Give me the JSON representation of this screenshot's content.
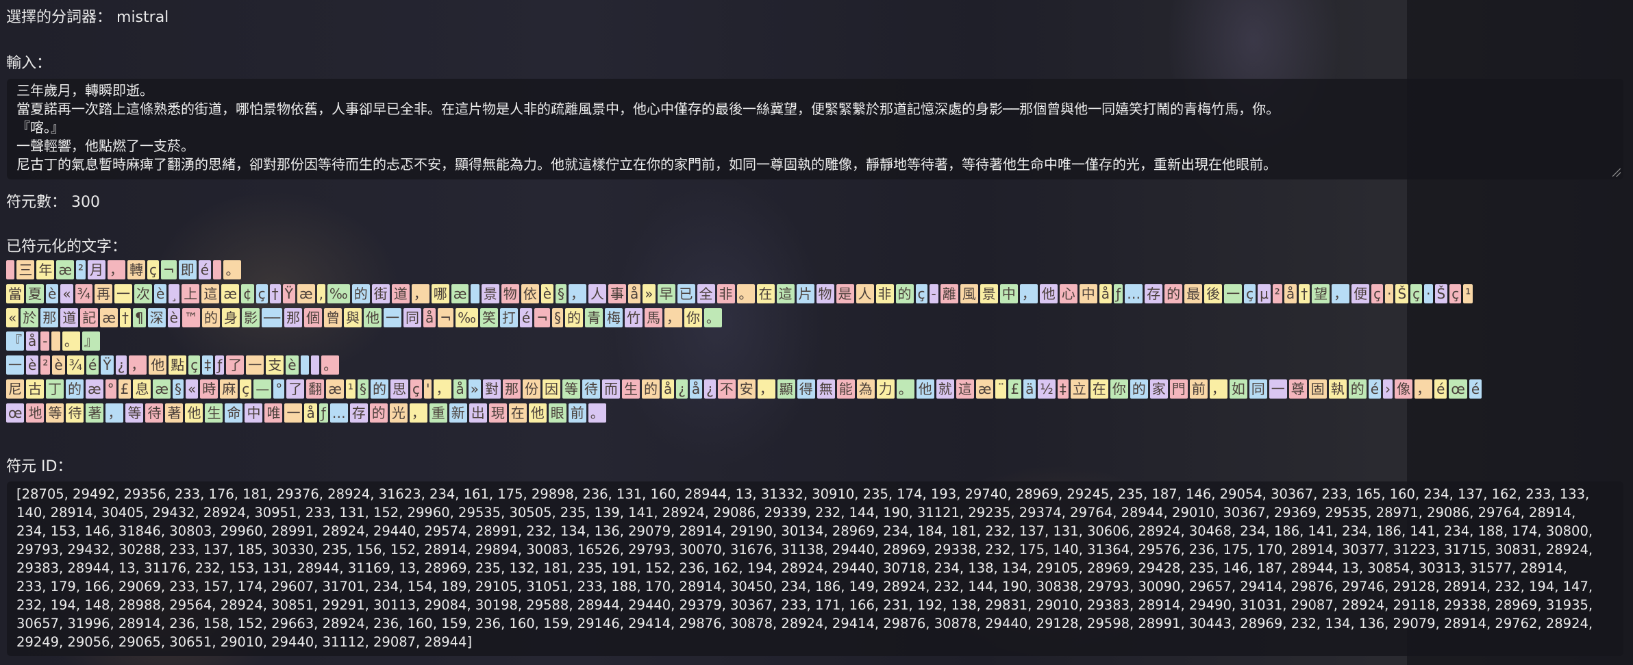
{
  "tokenizer": {
    "label": "選擇的分詞器：",
    "value": "mistral"
  },
  "input": {
    "label": "輸入：",
    "lines": [
      "三年歲月，轉瞬即逝。",
      "當夏諾再一次踏上這條熟悉的街道，哪怕景物依舊，人事卻早已全非。在這片物是人非的疏離風景中，他心中僅存的最後一絲冀望，便緊緊繫於那道記憶深處的身影──那個曾與他一同嬉笑打鬧的青梅竹馬，你。",
      "『喀。』",
      "一聲輕響，他點燃了一支菸。",
      "尼古丁的氣息暫時麻痺了翻湧的思緒，卻對那份因等待而生的忐忑不安，顯得無能為力。他就這樣佇立在你的家門前，如同一尊固執的雕像，靜靜地等待著，等待著他生命中唯一僅存的光，重新出現在他眼前。"
    ]
  },
  "token_count": {
    "label": "符元數：",
    "value": "300"
  },
  "tokenized": {
    "label": "已符元化的文字：",
    "rows": [
      [
        "",
        "三",
        "年",
        "æ",
        "²",
        "月",
        "，",
        "轉",
        "ç",
        "¬",
        "即",
        "é",
        "",
        "。"
      ],
      [
        "當",
        "夏",
        "è",
        "«",
        "¾",
        "再",
        "一",
        "次",
        "è",
        "¸",
        "上",
        "這",
        "æ",
        "¢",
        "ç",
        "†",
        "Ÿ",
        "æ",
        "‚",
        "‰",
        "的",
        "街",
        "道",
        "，",
        "哪",
        "æ",
        "",
        "景",
        "物",
        "依",
        "è",
        "§",
        "，",
        "人",
        "事",
        "å",
        "»",
        "早",
        "已",
        "全",
        "非",
        "。",
        "在",
        "這",
        "片",
        "物",
        "是",
        "人",
        "非",
        "的",
        "ç",
        "-",
        "離",
        "風",
        "景",
        "中",
        "，",
        "他",
        "心",
        "中",
        "å",
        "ƒ",
        "…",
        "存",
        "的",
        "最",
        "後",
        "一",
        "ç",
        "µ",
        "²",
        "å",
        "†",
        "望",
        "，",
        "便",
        "ç",
        "·",
        "Š",
        "ç",
        "·",
        "Š",
        "ç",
        "¹"
      ],
      [
        "«",
        "於",
        "那",
        "道",
        "記",
        "æ",
        "†",
        "¶",
        "深",
        "è",
        "™",
        "的",
        "身",
        "影",
        "──",
        "那",
        "個",
        "曾",
        "與",
        "他",
        "一",
        "同",
        "å",
        "¬",
        "‰",
        "笑",
        "打",
        "é",
        "¬",
        "§",
        "的",
        "青",
        "梅",
        "竹",
        "馬",
        "，",
        "你",
        "。"
      ],
      [
        "『",
        "å",
        "-",
        "",
        "。",
        "』"
      ],
      [
        "一",
        "è",
        "²",
        "è",
        "¾",
        "é",
        "Ÿ",
        "¿",
        "，",
        "他",
        "點",
        "ç",
        "‡",
        "ƒ",
        "了",
        "一",
        "支",
        "è",
        "",
        "",
        "。"
      ],
      [
        "尼",
        "古",
        "丁",
        "的",
        "æ",
        "°",
        "£",
        "息",
        "æ",
        "§",
        "«",
        "時",
        "麻",
        "ç",
        "—",
        "°",
        "了",
        "翻",
        "æ",
        "¹",
        "§",
        "的",
        "思",
        "ç",
        "'",
        "，",
        "å",
        "»",
        "對",
        "那",
        "份",
        "因",
        "等",
        "待",
        "而",
        "生",
        "的",
        "å",
        "¿",
        "å",
        "¿",
        "不",
        "安",
        "，",
        "顯",
        "得",
        "無",
        "能",
        "為",
        "力",
        "。",
        "他",
        "就",
        "這",
        "æ",
        "¨",
        "£",
        "ä",
        "½",
        "‡",
        "立",
        "在",
        "你",
        "的",
        "家",
        "門",
        "前",
        "，",
        "如",
        "同",
        "一",
        "尊",
        "固",
        "執",
        "的",
        "é",
        "›",
        "像",
        "，",
        "é",
        "œ",
        "é"
      ],
      [
        "œ",
        "地",
        "等",
        "待",
        "著",
        "，",
        "等",
        "待",
        "著",
        "他",
        "生",
        "命",
        "中",
        "唯",
        "一",
        "å",
        "ƒ",
        "…",
        "存",
        "的",
        "光",
        "，",
        "重",
        "新",
        "出",
        "現",
        "在",
        "他",
        "眼",
        "前",
        "。"
      ]
    ]
  },
  "token_ids": {
    "label": "符元 ID：",
    "lines": [
      "[28705, 29492, 29356, 233, 176, 181, 29376, 28924, 31623, 234, 161, 175, 29898, 236, 131, 160, 28944, 13, 31332, 30910, 235, 174, 193, 29740, 28969, 29245, 235, 187, 146, 29054, 30367, 233, 165, 160, 234, 137, 162, 233, 133,",
      "140, 28914, 30405, 29432, 28924, 30951, 233, 131, 152, 29960, 29535, 30505, 235, 139, 141, 28924, 29086, 29339, 232, 144, 190, 31121, 29235, 29374, 29764, 28944, 29010, 30367, 29369, 29535, 28971, 29086, 29764, 28914,",
      "234, 153, 146, 31846, 30803, 29960, 28991, 28924, 29440, 29574, 28991, 232, 134, 136, 29079, 28914, 29190, 30134, 28969, 234, 184, 181, 232, 137, 131, 30606, 28924, 30468, 234, 186, 141, 234, 186, 141, 234, 188, 174, 30800,",
      "29793, 29432, 30288, 233, 137, 185, 30330, 235, 156, 152, 28914, 29894, 30083, 16526, 29793, 30070, 31676, 31138, 29440, 28969, 29338, 232, 175, 140, 31364, 29576, 236, 175, 170, 28914, 30377, 31223, 31715, 30831, 28924,",
      "29383, 28944, 13, 31176, 232, 153, 131, 28944, 31169, 13, 28969, 235, 132, 181, 235, 191, 152, 236, 162, 194, 28924, 29440, 30718, 234, 138, 134, 29105, 28969, 29428, 235, 146, 187, 28944, 13, 30854, 30313, 31577, 28914,",
      "233, 179, 166, 29069, 233, 157, 174, 29607, 31701, 234, 154, 189, 29105, 31051, 233, 188, 170, 28914, 30450, 234, 186, 149, 28924, 232, 144, 190, 30838, 29793, 30090, 29657, 29414, 29876, 29746, 29128, 28914, 232, 194, 147,",
      "232, 194, 148, 28988, 29564, 28924, 30851, 29291, 30113, 29084, 30198, 29588, 28944, 29440, 29379, 30367, 233, 171, 166, 231, 192, 138, 29831, 29010, 29383, 28914, 29490, 31031, 29087, 28924, 29118, 29338, 28969, 31935,",
      "30657, 31996, 28914, 236, 158, 152, 29663, 28924, 236, 160, 159, 236, 160, 159, 29146, 29414, 29876, 30878, 28924, 29414, 29876, 30878, 29440, 29128, 29598, 28991, 30443, 28969, 232, 134, 136, 29079, 28914, 29762, 28924,",
      "29249, 29056, 29065, 30651, 29010, 29440, 31112, 29087, 28944]"
    ]
  }
}
